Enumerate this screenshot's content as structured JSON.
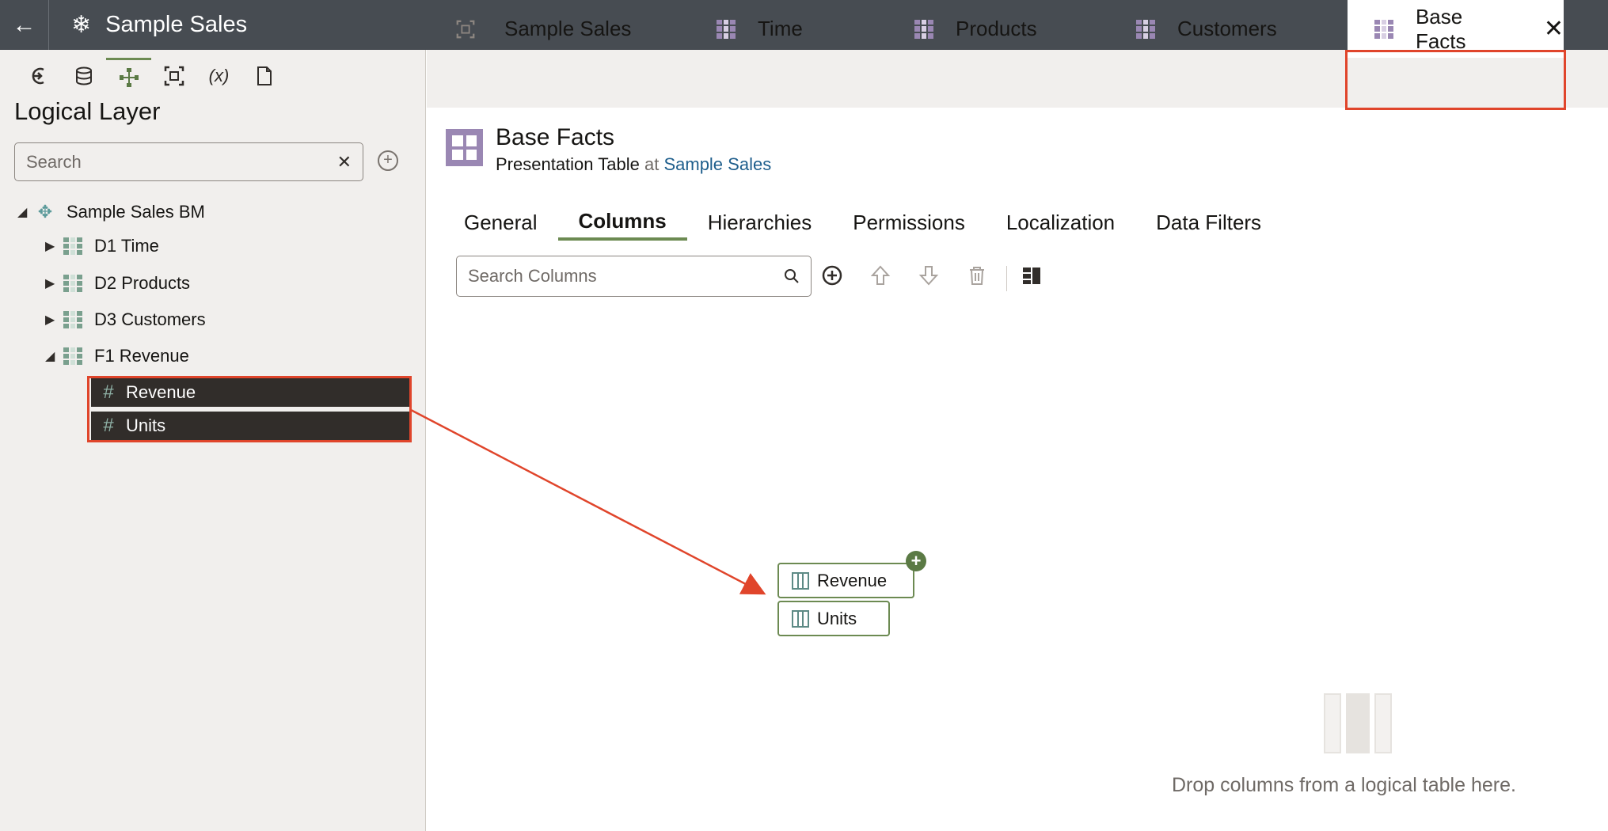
{
  "header": {
    "back_icon": "arrow-left-icon",
    "app_icon": "snowflake-icon",
    "title": "Sample Sales"
  },
  "left_panel": {
    "tools": [
      "connections-icon",
      "database-icon",
      "logical-layer-icon",
      "presentation-icon",
      "variables-icon",
      "document-icon"
    ],
    "title": "Logical Layer",
    "search": {
      "placeholder": "Search",
      "value": ""
    },
    "tree": {
      "root": "Sample Sales BM",
      "tables": [
        {
          "label": "D1 Time",
          "expanded": false
        },
        {
          "label": "D2 Products",
          "expanded": false
        },
        {
          "label": "D3 Customers",
          "expanded": false
        },
        {
          "label": "F1 Revenue",
          "expanded": true
        }
      ],
      "selected_columns": [
        "Revenue",
        "Units"
      ]
    }
  },
  "tabs": [
    {
      "label": "Sample Sales",
      "icon": "presentation-icon"
    },
    {
      "label": "Time",
      "icon": "table-icon"
    },
    {
      "label": "Products",
      "icon": "table-icon"
    },
    {
      "label": "Customers",
      "icon": "table-icon"
    },
    {
      "label": "Base Facts",
      "icon": "table-icon",
      "active": true
    }
  ],
  "detail": {
    "title": "Base Facts",
    "subtitle_type": "Presentation Table",
    "subtitle_at": "at",
    "subtitle_link": "Sample Sales",
    "subtabs": [
      "General",
      "Columns",
      "Hierarchies",
      "Permissions",
      "Localization",
      "Data Filters"
    ],
    "active_subtab": "Columns",
    "column_search": {
      "placeholder": "Search Columns",
      "value": ""
    },
    "dragged_columns": [
      "Revenue",
      "Units"
    ],
    "drop_hint": "Drop columns from a logical table here."
  },
  "colors": {
    "accent": "#6c8a52",
    "highlight": "#e0452b",
    "topbar": "#474c52",
    "table_icon": "#9a87b3"
  }
}
